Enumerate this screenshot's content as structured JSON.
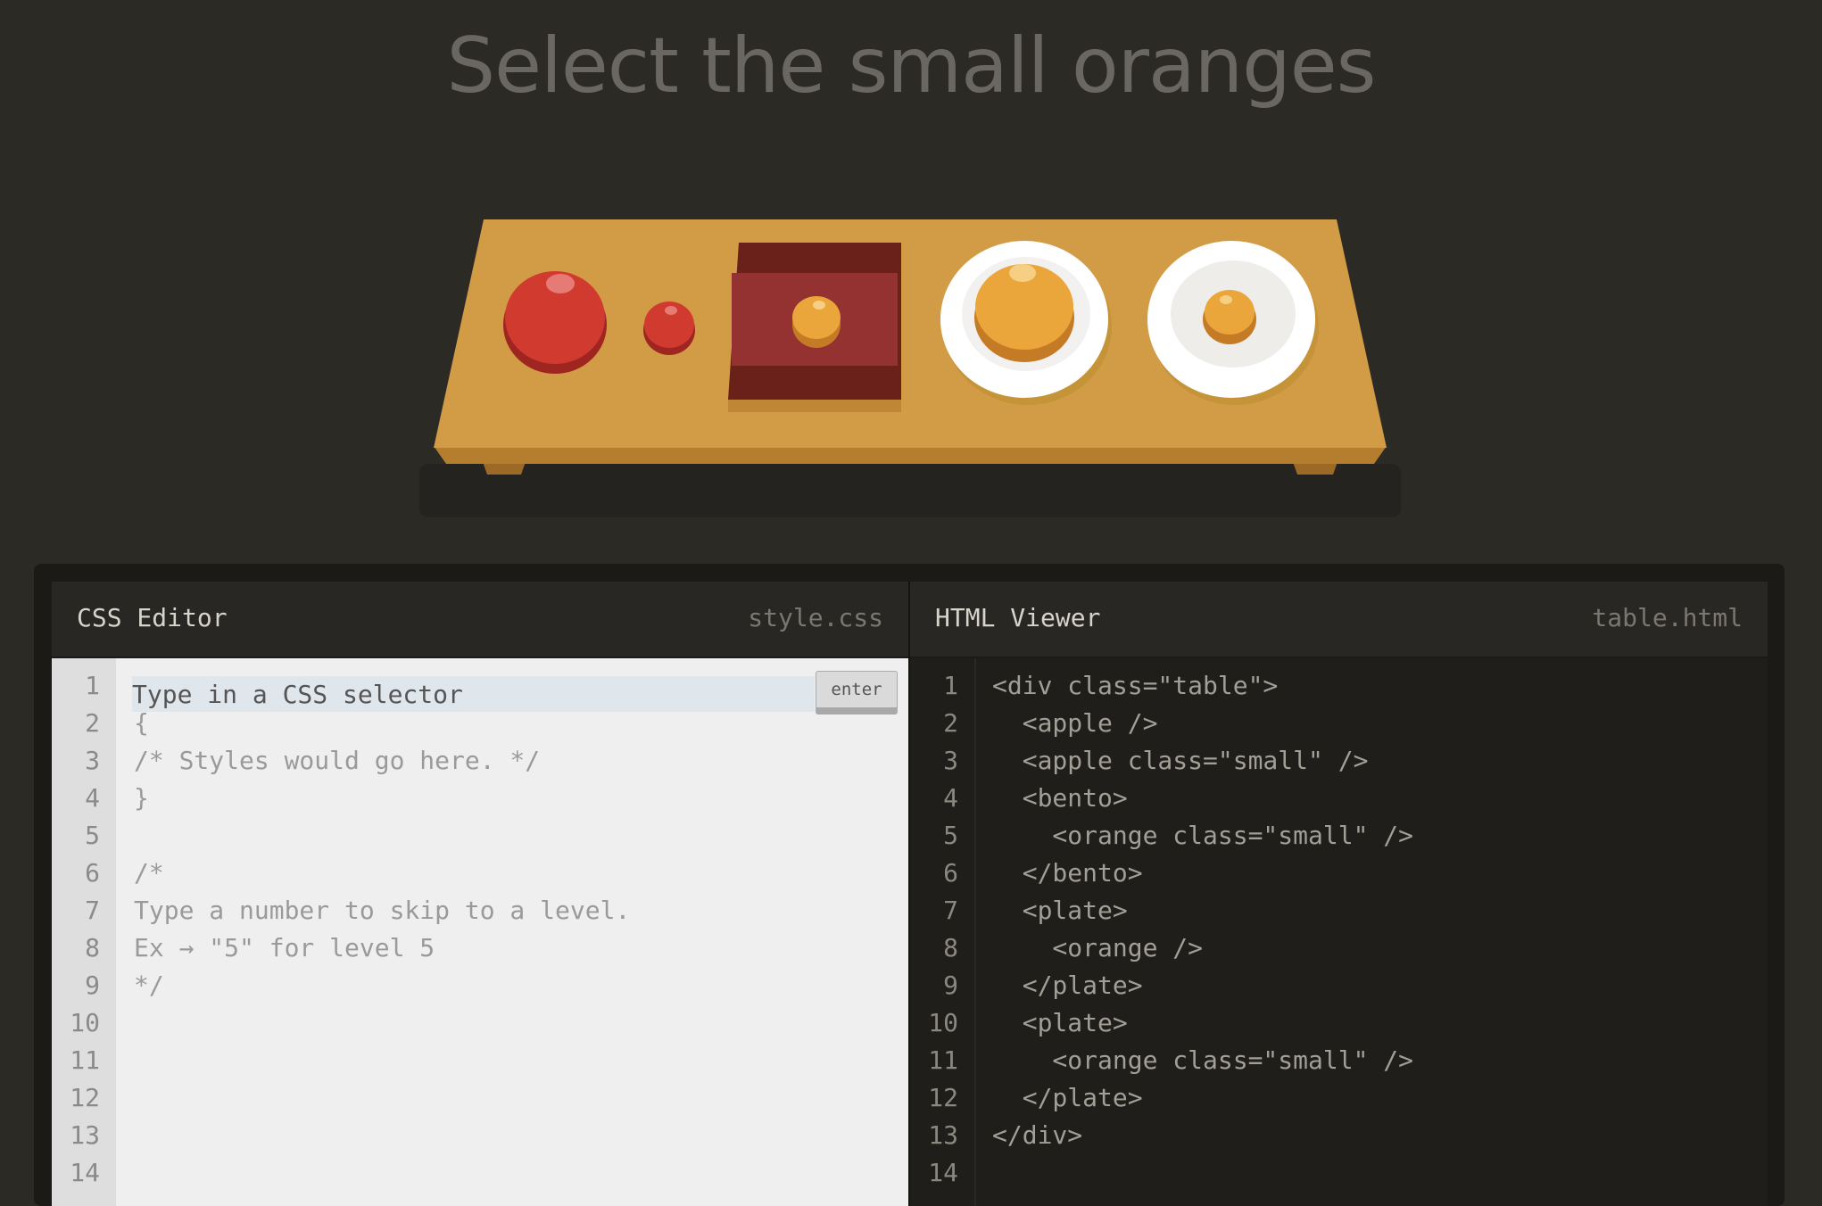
{
  "title": "Select the small oranges",
  "colors": {
    "background": "#2c2a25",
    "table_top": "#d29b46",
    "table_edge": "#b57e2e",
    "apple": "#d13a2f",
    "apple_shadow": "#9f2620",
    "orange": "#eaa63b",
    "orange_shadow": "#c57b26",
    "bento": "#933230",
    "bento_rim": "#6a211a",
    "plate": "#ffffff"
  },
  "table_items": [
    {
      "type": "apple",
      "size": "large"
    },
    {
      "type": "apple",
      "size": "small"
    },
    {
      "type": "bento",
      "contains": {
        "type": "orange",
        "size": "small"
      }
    },
    {
      "type": "plate",
      "contains": {
        "type": "orange",
        "size": "large"
      }
    },
    {
      "type": "plate",
      "contains": {
        "type": "orange",
        "size": "small"
      }
    }
  ],
  "css_editor": {
    "title": "CSS Editor",
    "filename": "style.css",
    "input_placeholder": "Type in a CSS selector",
    "enter_label": "enter",
    "line_numbers": [
      "1",
      "2",
      "3",
      "4",
      "5",
      "6",
      "7",
      "8",
      "9",
      "10",
      "11",
      "12",
      "13",
      "14"
    ],
    "lines": [
      "",
      "{",
      "/* Styles would go here. */",
      "}",
      "",
      "/*",
      "Type a number to skip to a level.",
      "Ex → \"5\" for level 5",
      "*/",
      "",
      "",
      "",
      "",
      ""
    ]
  },
  "html_viewer": {
    "title": "HTML Viewer",
    "filename": "table.html",
    "line_numbers": [
      "1",
      "2",
      "3",
      "4",
      "5",
      "6",
      "7",
      "8",
      "9",
      "10",
      "11",
      "12",
      "13",
      "14"
    ],
    "lines": [
      "<div class=\"table\">",
      "  <apple />",
      "  <apple class=\"small\" />",
      "  <bento>",
      "    <orange class=\"small\" />",
      "  </bento>",
      "  <plate>",
      "    <orange />",
      "  </plate>",
      "  <plate>",
      "    <orange class=\"small\" />",
      "  </plate>",
      "</div>",
      ""
    ]
  }
}
